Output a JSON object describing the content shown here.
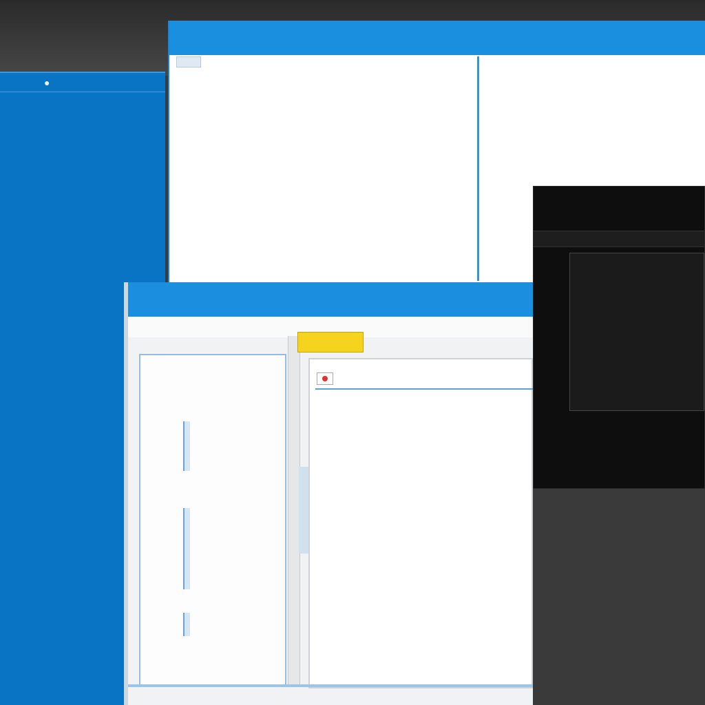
{
  "back_window": {
    "title": "",
    "status": ""
  },
  "list_window": {
    "caption_left": "",
    "caption_right": "",
    "col1": [
      "",
      "",
      "",
      "",
      "",
      "",
      "",
      "",
      "",
      "",
      "",
      "",
      "",
      "",
      "",
      ""
    ],
    "col2": [
      "",
      "",
      "",
      "",
      "",
      "",
      "",
      "",
      "",
      "",
      "",
      "",
      "",
      "",
      "",
      ""
    ],
    "col3": [
      "",
      "",
      "",
      "",
      "",
      "",
      "",
      "",
      "",
      "",
      "",
      "",
      "",
      "",
      "",
      ""
    ]
  },
  "detail_pane": {
    "title": "",
    "subtitle": ""
  },
  "terminal": {
    "title": "",
    "menu": "",
    "lines": [
      "",
      "",
      "",
      "",
      "",
      "",
      "",
      "",
      "",
      ""
    ]
  },
  "editor": {
    "menu_label": "",
    "tag": "",
    "left_title": "",
    "left_sub": "",
    "address": "",
    "url": "",
    "body": [
      "",
      "",
      "",
      "",
      ""
    ]
  }
}
